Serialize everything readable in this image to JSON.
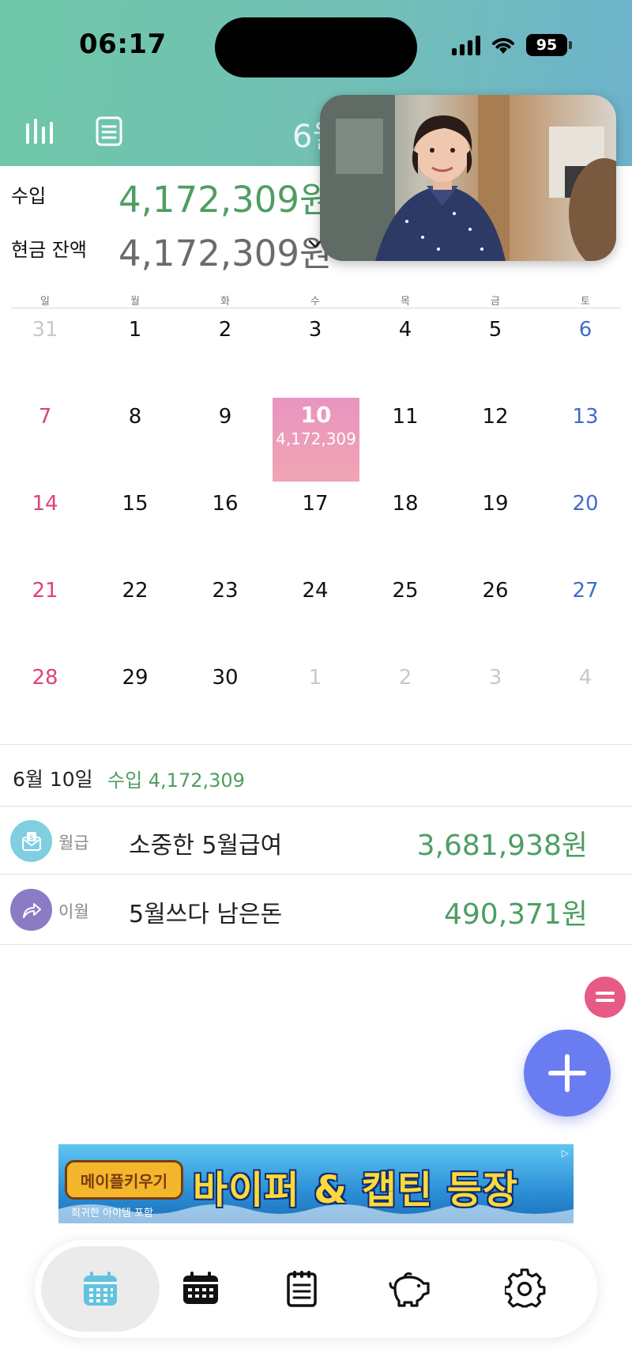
{
  "status": {
    "time": "06:17",
    "battery": "95"
  },
  "header": {
    "month_title": "6월"
  },
  "summary": {
    "income_label": "수입",
    "income_value": "4,172,309원",
    "balance_label": "현금 잔액",
    "balance_value": "4,172,309원"
  },
  "calendar": {
    "weekdays": [
      "일",
      "월",
      "화",
      "수",
      "목",
      "금",
      "토"
    ],
    "weeks": [
      [
        "31",
        "1",
        "2",
        "3",
        "4",
        "5",
        "6"
      ],
      [
        "7",
        "8",
        "9",
        "10",
        "11",
        "12",
        "13"
      ],
      [
        "14",
        "15",
        "16",
        "17",
        "18",
        "19",
        "20"
      ],
      [
        "21",
        "22",
        "23",
        "24",
        "25",
        "26",
        "27"
      ],
      [
        "28",
        "29",
        "30",
        "1",
        "2",
        "3",
        "4"
      ]
    ],
    "selected_day": "10",
    "selected_amount": "4,172,309"
  },
  "detail": {
    "date": "6월 10일",
    "income_summary": "수입 4,172,309",
    "items": [
      {
        "category": "월급",
        "title": "소중한 5월급여",
        "amount": "3,681,938원",
        "icon": "salary-envelope-icon",
        "icon_color": "#7fcfe0"
      },
      {
        "category": "이월",
        "title": "5월쓰다 남은돈",
        "amount": "490,371원",
        "icon": "carry-over-arrow-icon",
        "icon_color": "#8a7bc4"
      }
    ]
  },
  "ad": {
    "logo_text": "메이플키우기",
    "headline": "바이퍼 & 캡틴 등장",
    "subtext": "희귀한 아이템 포함"
  },
  "tabs": [
    {
      "name": "calendar-month",
      "icon": "calendar-icon",
      "active": true
    },
    {
      "name": "calendar-week",
      "icon": "calendar-dark-icon",
      "active": false
    },
    {
      "name": "list",
      "icon": "notepad-icon",
      "active": false
    },
    {
      "name": "savings",
      "icon": "piggy-bank-icon",
      "active": false
    },
    {
      "name": "settings",
      "icon": "gear-icon",
      "active": false
    }
  ],
  "colors": {
    "header_gradient": [
      "#6fc7a7",
      "#6db2cc"
    ],
    "income_green": "#4e9e63",
    "sunday": "#e0417c",
    "saturday": "#3f6ccf",
    "selected_day_bg": "#ec9dbb",
    "fab": "#6a7df0",
    "fab_mini": "#e85a86"
  }
}
